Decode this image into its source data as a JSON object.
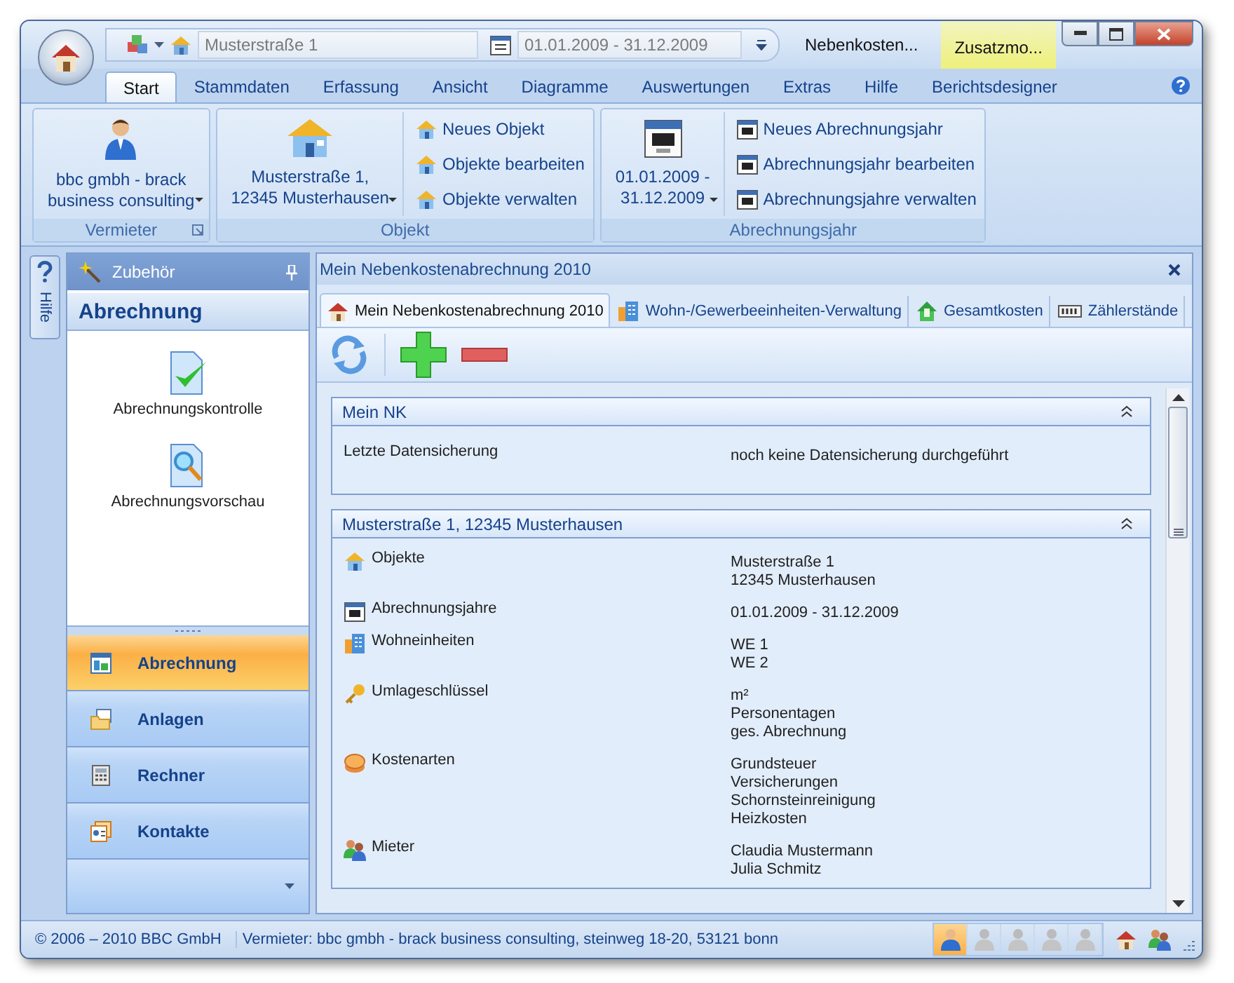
{
  "title_bar": {
    "object_field": "Musterstraße 1",
    "period_field": "01.01.2009 - 31.12.2009",
    "title": "Nebenkosten...",
    "contextual_tab": "Zusatzmo..."
  },
  "ribbon_tabs": [
    {
      "label": "Start",
      "selected": true
    },
    {
      "label": "Stammdaten",
      "selected": false
    },
    {
      "label": "Erfassung",
      "selected": false
    },
    {
      "label": "Ansicht",
      "selected": false
    },
    {
      "label": "Diagramme",
      "selected": false
    },
    {
      "label": "Auswertungen",
      "selected": false
    },
    {
      "label": "Extras",
      "selected": false
    },
    {
      "label": "Hilfe",
      "selected": false
    },
    {
      "label": "Berichtsdesigner",
      "selected": false
    }
  ],
  "ribbon_groups": [
    {
      "title": "Vermieter",
      "launcher": true,
      "large": {
        "kind": "person",
        "lines": [
          "bbc gmbh - brack",
          "business consulting"
        ]
      }
    },
    {
      "title": "Objekt",
      "launcher": false,
      "large": {
        "kind": "house",
        "lines": [
          "Musterstraße 1,",
          "12345 Musterhausen"
        ]
      },
      "small": [
        {
          "kind": "house",
          "label": "Neues Objekt"
        },
        {
          "kind": "house",
          "label": "Objekte bearbeiten"
        },
        {
          "kind": "house",
          "label": "Objekte verwalten"
        }
      ]
    },
    {
      "title": "Abrechnungsjahr",
      "launcher": false,
      "large": {
        "kind": "calendar",
        "lines": [
          "01.01.2009 -",
          "31.12.2009"
        ]
      },
      "small": [
        {
          "kind": "calendar",
          "label": "Neues Abrechnungsjahr"
        },
        {
          "kind": "calendar",
          "label": "Abrechnungsjahr bearbeiten"
        },
        {
          "kind": "calendar",
          "label": "Abrechnungsjahre verwalten"
        }
      ]
    }
  ],
  "side_tab": {
    "label": "Hilfe"
  },
  "nav_pane": {
    "header": "Zubehör",
    "section_title": "Abrechnung",
    "tools": [
      {
        "kind": "check",
        "label": "Abrechnungskontrolle"
      },
      {
        "kind": "preview",
        "label": "Abrechnungsvorschau"
      }
    ],
    "buttons": [
      {
        "kind": "table",
        "label": "Abrechnung",
        "selected": true
      },
      {
        "kind": "folder",
        "label": "Anlagen",
        "selected": false
      },
      {
        "kind": "calculator",
        "label": "Rechner",
        "selected": false
      },
      {
        "kind": "contacts",
        "label": "Kontakte",
        "selected": false
      }
    ]
  },
  "document": {
    "title": "Mein Nebenkostenabrechnung 2010",
    "tabs": [
      {
        "kind": "house",
        "label": "Mein Nebenkostenabrechnung 2010",
        "selected": true
      },
      {
        "kind": "building",
        "label": "Wohn-/Gewerbeeinheiten-Verwaltung",
        "selected": false
      },
      {
        "kind": "money",
        "label": "Gesamtkosten",
        "selected": false
      },
      {
        "kind": "meter",
        "label": "Zählerstände",
        "selected": false
      }
    ],
    "panels": [
      {
        "title": "Mein NK",
        "rows": [
          {
            "kind": "plain",
            "label": "Letzte Datensicherung",
            "values": [
              "noch keine Datensicherung durchgeführt"
            ]
          }
        ]
      },
      {
        "title": "Musterstraße 1, 12345 Musterhausen",
        "rows": [
          {
            "kind": "house",
            "label": "Objekte",
            "values": [
              "Musterstraße 1",
              "12345 Musterhausen"
            ]
          },
          {
            "kind": "calendar",
            "label": "Abrechnungsjahre",
            "values": [
              "01.01.2009 - 31.12.2009"
            ]
          },
          {
            "kind": "building",
            "label": "Wohneinheiten",
            "values": [
              "WE 1",
              "WE 2"
            ]
          },
          {
            "kind": "key",
            "label": "Umlageschlüssel",
            "values": [
              "m²",
              "Personentagen",
              "ges. Abrechnung"
            ]
          },
          {
            "kind": "coins",
            "label": "Kostenarten",
            "values": [
              "Grundsteuer",
              "Versicherungen",
              "Schornsteinreinigung",
              "Heizkosten"
            ]
          },
          {
            "kind": "people",
            "label": "Mieter",
            "values": [
              "Claudia Mustermann",
              "Julia Schmitz"
            ]
          }
        ]
      }
    ]
  },
  "status_bar": {
    "copyright": "© 2006 – 2010 BBC GmbH",
    "landlord": "Vermieter: bbc gmbh - brack business consulting, steinweg 18-20, 53121 bonn",
    "user_slots": [
      {
        "selected": true
      },
      {
        "selected": false
      },
      {
        "selected": false
      },
      {
        "selected": false
      },
      {
        "selected": false
      }
    ]
  }
}
